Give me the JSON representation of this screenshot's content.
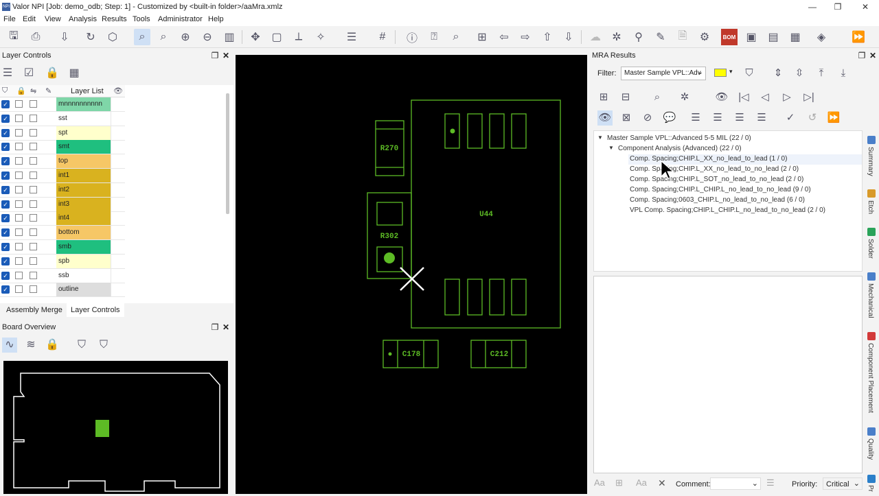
{
  "window": {
    "title": "Valor NPI [Job: demo_odb; Step: 1] - Customized by <built-in folder>/aaMra.xmlz",
    "icon": "NPI"
  },
  "menu": [
    "File",
    "Edit",
    "View",
    "Analysis",
    "Results",
    "Tools",
    "Administrator",
    "Help"
  ],
  "layer_controls": {
    "title": "Layer Controls",
    "header_label": "Layer List",
    "layers": [
      {
        "name": "mnnnnnnnnnn",
        "color": "#7fd6a8",
        "checked": true
      },
      {
        "name": "sst",
        "color": "#ffffff",
        "checked": true
      },
      {
        "name": "spt",
        "color": "#ffffcc",
        "checked": true
      },
      {
        "name": "smt",
        "color": "#1fbf7f",
        "checked": true
      },
      {
        "name": "top",
        "color": "#f6c766",
        "checked": true
      },
      {
        "name": "int1",
        "color": "#d9b21f",
        "checked": true
      },
      {
        "name": "int2",
        "color": "#d9b21f",
        "checked": true
      },
      {
        "name": "int3",
        "color": "#d9b21f",
        "checked": true
      },
      {
        "name": "int4",
        "color": "#d9b21f",
        "checked": true
      },
      {
        "name": "bottom",
        "color": "#f6c766",
        "checked": true
      },
      {
        "name": "smb",
        "color": "#1fbf7f",
        "checked": true
      },
      {
        "name": "spb",
        "color": "#ffffcc",
        "checked": true
      },
      {
        "name": "ssb",
        "color": "#ffffff",
        "checked": true
      },
      {
        "name": "outline",
        "color": "#dddddd",
        "checked": true
      }
    ],
    "tabs": [
      "Assembly Merge",
      "Layer Controls"
    ],
    "active_tab": "Layer Controls"
  },
  "board_overview": {
    "title": "Board Overview"
  },
  "board": {
    "components": [
      "R270",
      "R302",
      "U44",
      "C178",
      "C212"
    ]
  },
  "mra": {
    "title": "MRA Results",
    "filter_label": "Filter:",
    "filter_value": "Master Sample VPL::Adv",
    "tree_root": "Master Sample VPL::Advanced 5-5 MIL (22 / 0)",
    "tree_group": "Component Analysis (Advanced) (22 / 0)",
    "tree_items": [
      "Comp. Spacing;CHIP.L_XX_no_lead_to_lead (1 / 0)",
      "Comp. Spacing;CHIP.L_XX_no_lead_to_no_lead (2 / 0)",
      "Comp. Spacing;CHIP.L_SOT_no_lead_to_no_lead (2 / 0)",
      "Comp. Spacing;CHIP.L_CHIP.L_no_lead_to_no_lead (9 / 0)",
      "Comp. Spacing;0603_CHIP.L_no_lead_to_no_lead (6 / 0)",
      "VPL Comp. Spacing;CHIP.L_CHIP.L_no_lead_to_no_lead (2 / 0)"
    ],
    "comment_label": "Comment:",
    "priority_label": "Priority:",
    "priority_value": "Critical",
    "side_tabs": [
      "Summary",
      "Etch",
      "Solder",
      "Mechanical",
      "Component Placement",
      "Quality",
      "Pr"
    ],
    "side_colors": [
      "#4a7fc9",
      "#d89a2a",
      "#2aa35a",
      "#4a7fc9",
      "#d23a3a",
      "#4a7fc9",
      "#2a7fc9"
    ]
  }
}
